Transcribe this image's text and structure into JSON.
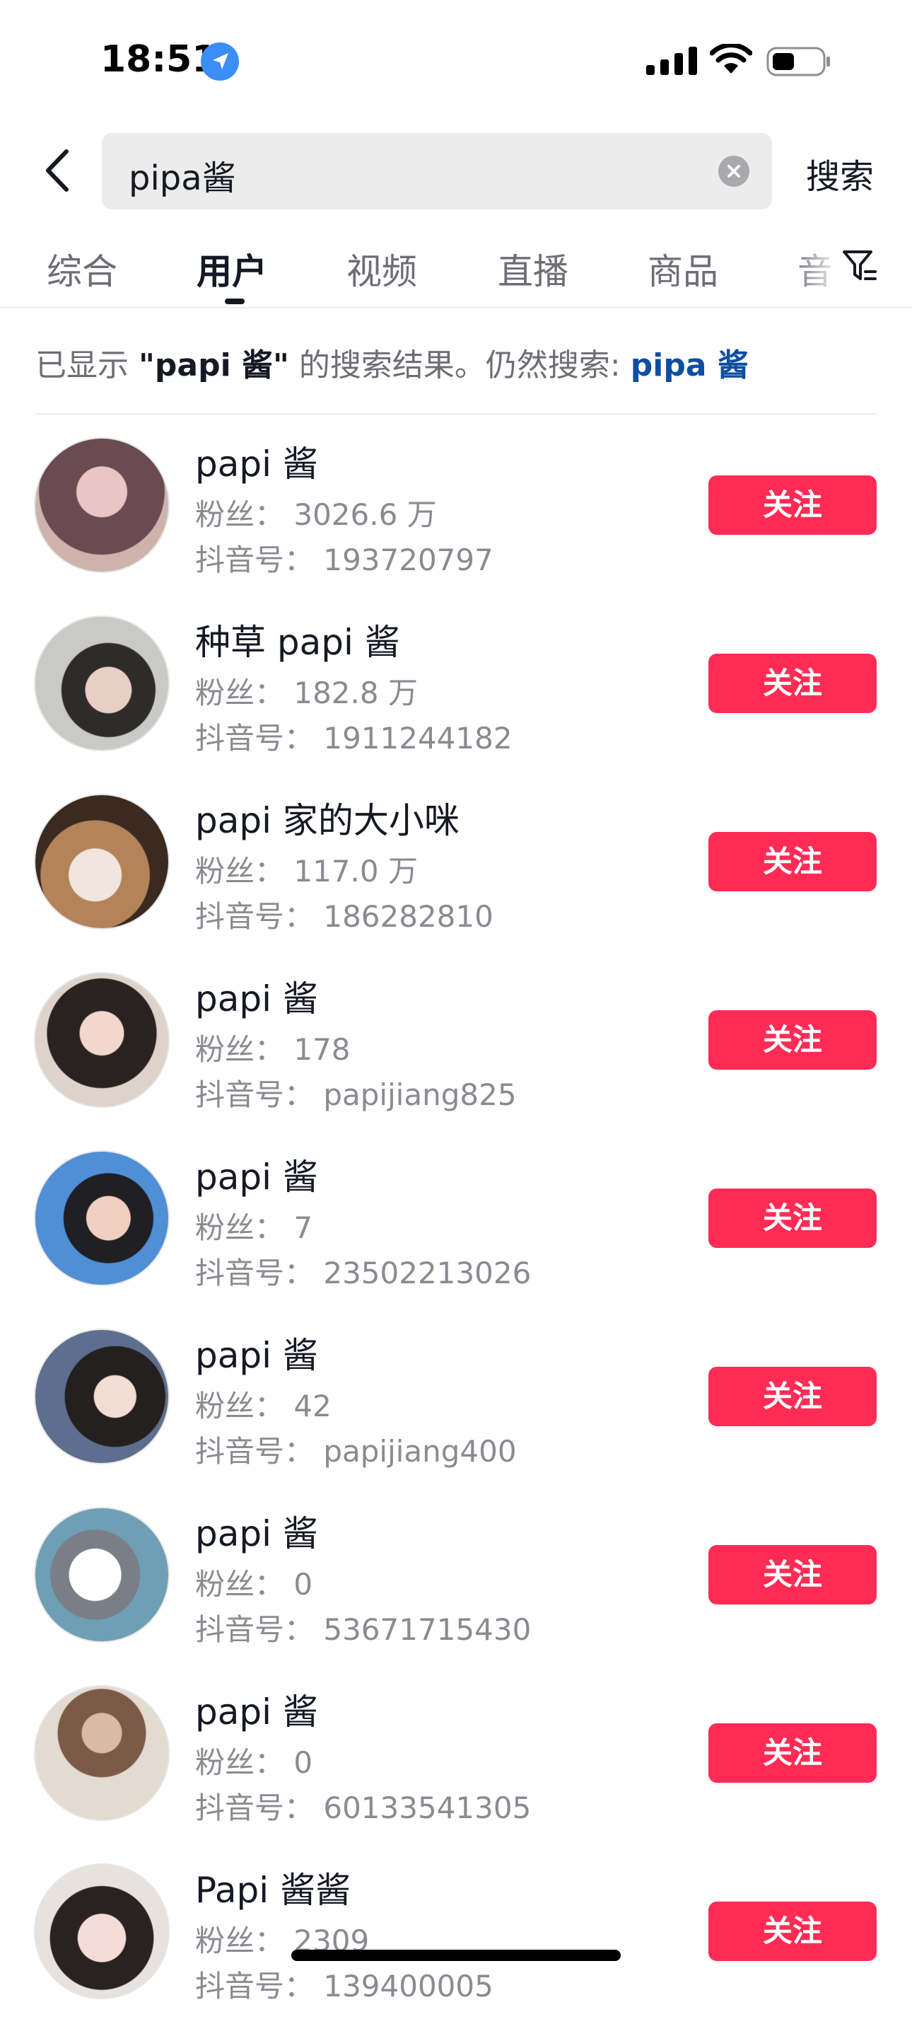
{
  "status_bar": {
    "time": "18:51"
  },
  "search": {
    "query": "pipa酱",
    "submit_label": "搜索"
  },
  "tabs": [
    {
      "label": "综合"
    },
    {
      "label": "用户"
    },
    {
      "label": "视频"
    },
    {
      "label": "直播"
    },
    {
      "label": "商品"
    },
    {
      "label": "音"
    }
  ],
  "notice": {
    "prefix": "已显示 ",
    "quoted": "\"papi 酱\"",
    "middle": " 的搜索结果。仍然搜索: ",
    "link": "pipa 酱"
  },
  "follow_label": "关注",
  "users": [
    {
      "name": "papi 酱",
      "fans": "粉丝： 3026.6 万",
      "id": "抖音号： 193720797",
      "avatar_color": "#6a4b52"
    },
    {
      "name": "种草 papi 酱",
      "fans": "粉丝： 182.8 万",
      "id": "抖音号： 1911244182",
      "avatar_color": "#8a8a86"
    },
    {
      "name": "papi 家的大小咪",
      "fans": "粉丝： 117.0 万",
      "id": "抖音号： 186282810",
      "avatar_color": "#7a5a3e"
    },
    {
      "name": "papi 酱",
      "fans": "粉丝： 178",
      "id": "抖音号： papijiang825",
      "avatar_color": "#3c302c"
    },
    {
      "name": "papi 酱",
      "fans": "粉丝： 7",
      "id": "抖音号： 23502213026",
      "avatar_color": "#4f8fd6"
    },
    {
      "name": "papi 酱",
      "fans": "粉丝： 42",
      "id": "抖音号： papijiang400",
      "avatar_color": "#4a4640"
    },
    {
      "name": "papi 酱",
      "fans": "粉丝： 0",
      "id": "抖音号： 53671715430",
      "avatar_color": "#6d8f9e"
    },
    {
      "name": "papi 酱",
      "fans": "粉丝： 0",
      "id": "抖音号： 60133541305",
      "avatar_color": "#b7a997"
    },
    {
      "name": "Papi 酱酱",
      "fans": "粉丝： 2309",
      "id": "抖音号： 139400005",
      "avatar_color": "#d7c2be"
    }
  ]
}
